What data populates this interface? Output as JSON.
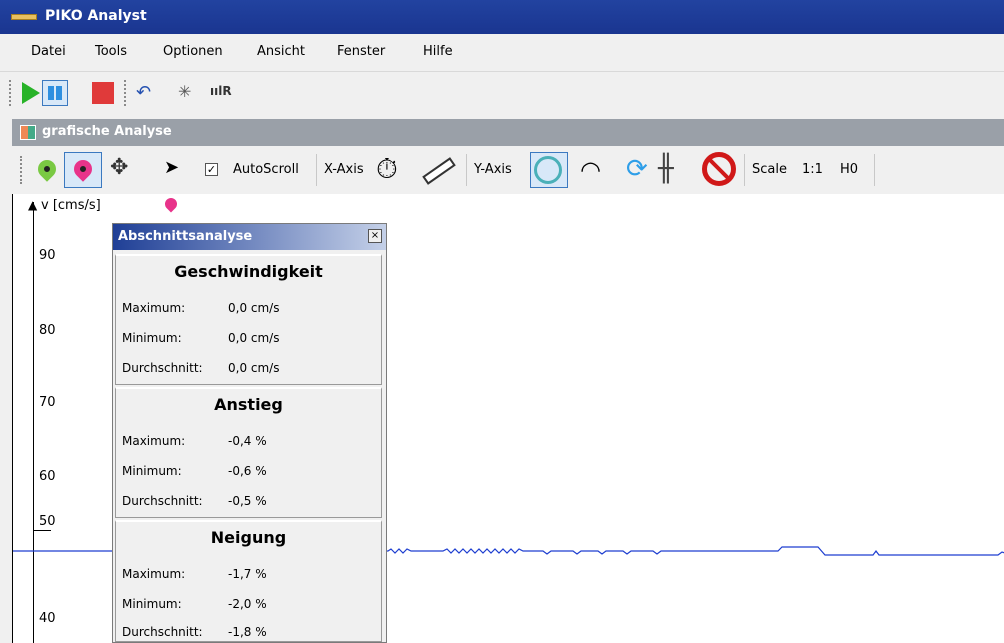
{
  "window": {
    "title": "PIKO Analyst"
  },
  "menu": [
    "Datei",
    "Tools",
    "Optionen",
    "Ansicht",
    "Fenster",
    "Hilfe"
  ],
  "toolbar": {
    "icons": [
      "play-icon",
      "pause-icon",
      "stop-icon",
      "undo-icon",
      "star-icon",
      "wave-icon"
    ]
  },
  "document": {
    "title": "grafische Analyse"
  },
  "analysis_toolbar": {
    "autoscroll_label": "AutoScroll",
    "autoscroll_checked": "✓",
    "x_axis_label": "X-Axis",
    "y_axis_label": "Y-Axis",
    "scale_label": "Scale",
    "scale_value": "1:1",
    "h_value": "H0"
  },
  "plot": {
    "y_unit": "v [cms/s]",
    "y_ticks": [
      "90",
      "80",
      "70",
      "60",
      "50",
      "40"
    ],
    "series_color": "#1f3fd0"
  },
  "panel": {
    "title": "Abschnittsanalyse",
    "close": "×",
    "sections": [
      {
        "title": "Geschwindigkeit",
        "rows": [
          {
            "label": "Maximum:",
            "value": "0,0 cm/s"
          },
          {
            "label": "Minimum:",
            "value": "0,0 cm/s"
          },
          {
            "label": "Durchschnitt:",
            "value": "0,0 cm/s"
          }
        ]
      },
      {
        "title": "Anstieg",
        "rows": [
          {
            "label": "Maximum:",
            "value": "-0,4 %"
          },
          {
            "label": "Minimum:",
            "value": "-0,6 %"
          },
          {
            "label": "Durchschnitt:",
            "value": "-0,5 %"
          }
        ]
      },
      {
        "title": "Neigung",
        "rows": [
          {
            "label": "Maximum:",
            "value": "-1,7 %"
          },
          {
            "label": "Minimum:",
            "value": "-2,0 %"
          },
          {
            "label": "Durchschnitt:",
            "value": "-1,8 %"
          }
        ]
      }
    ]
  }
}
